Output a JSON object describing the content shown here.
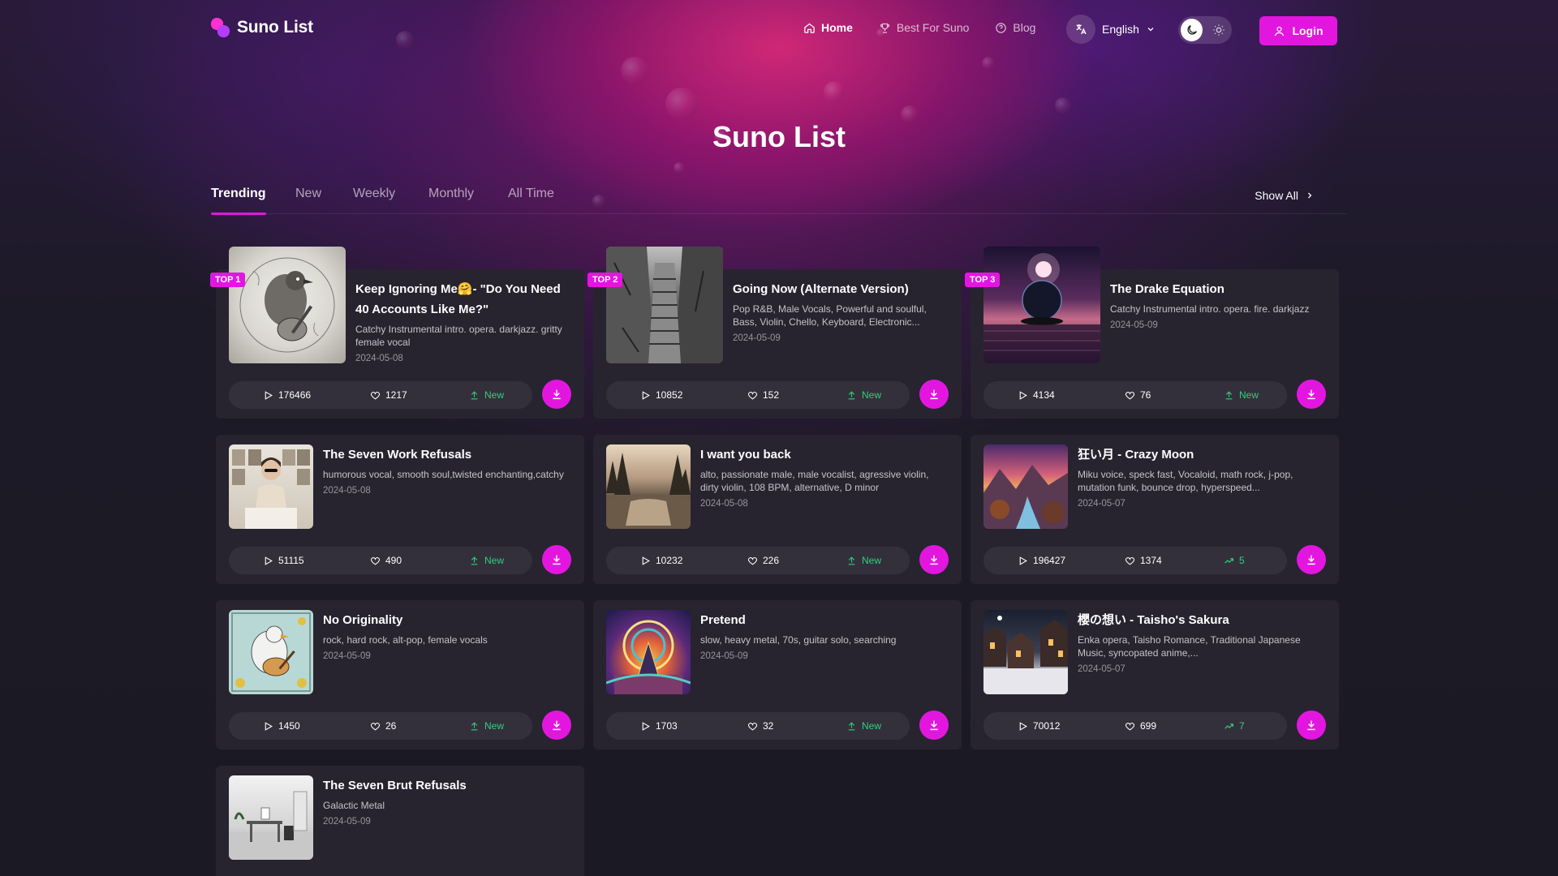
{
  "brand": {
    "name": "Suno List"
  },
  "nav": {
    "home": "Home",
    "best": "Best For Suno",
    "blog": "Blog",
    "language": "English",
    "login": "Login"
  },
  "hero": {
    "title": "Suno List"
  },
  "tabs": [
    "Trending",
    "New",
    "Weekly",
    "Monthly",
    "All Time"
  ],
  "show_all": "Show All",
  "colors": {
    "accent": "#e316e0",
    "trend_green": "#2fd17a",
    "card_bg": "#272430",
    "page_bg": "#1b1a24"
  },
  "songs": [
    {
      "rank": "TOP 1",
      "title": "Keep Ignoring Me🤗- \"Do You Need 40 Accounts Like Me?\"",
      "tags": "Catchy Instrumental intro. opera. darkjazz. gritty female vocal",
      "date": "2024-05-08",
      "plays": "176466",
      "likes": "1217",
      "trend": "New",
      "trend_icon": "upload-icon"
    },
    {
      "rank": "TOP 2",
      "title": "Going Now (Alternate Version)",
      "tags": "Pop R&B, Male Vocals, Powerful and soulful, Bass, Violin, Chello, Keyboard, Electronic...",
      "date": "2024-05-09",
      "plays": "10852",
      "likes": "152",
      "trend": "New",
      "trend_icon": "upload-icon"
    },
    {
      "rank": "TOP 3",
      "title": "The Drake Equation",
      "tags": "Catchy Instrumental intro. opera. fire. darkjazz",
      "date": "2024-05-09",
      "plays": "4134",
      "likes": "76",
      "trend": "New",
      "trend_icon": "upload-icon"
    },
    {
      "title": "The Seven Work Refusals",
      "tags": "humorous vocal, smooth soul,twisted enchanting,catchy",
      "date": "2024-05-08",
      "plays": "51115",
      "likes": "490",
      "trend": "New",
      "trend_icon": "upload-icon"
    },
    {
      "title": "I want you back",
      "tags": "alto, passionate male, male vocalist, agressive violin, dirty violin, 108 BPM, alternative, D minor",
      "date": "2024-05-08",
      "plays": "10232",
      "likes": "226",
      "trend": "New",
      "trend_icon": "upload-icon"
    },
    {
      "title": "狂い月 - Crazy Moon",
      "tags": "Miku voice, speck fast, Vocaloid, math rock, j-pop, mutation funk, bounce drop, hyperspeed...",
      "date": "2024-05-07",
      "plays": "196427",
      "likes": "1374",
      "trend": "5",
      "trend_icon": "trending-up-icon"
    },
    {
      "title": "No Originality",
      "tags": "rock, hard rock, alt-pop, female vocals",
      "date": "2024-05-09",
      "plays": "1450",
      "likes": "26",
      "trend": "New",
      "trend_icon": "upload-icon"
    },
    {
      "title": "Pretend",
      "tags": "slow, heavy metal, 70s, guitar solo, searching",
      "date": "2024-05-09",
      "plays": "1703",
      "likes": "32",
      "trend": "New",
      "trend_icon": "upload-icon"
    },
    {
      "title": "櫻の想い - Taisho's Sakura",
      "tags": "Enka opera, Taisho Romance, Traditional Japanese Music, syncopated anime,...",
      "date": "2024-05-07",
      "plays": "70012",
      "likes": "699",
      "trend": "7",
      "trend_icon": "trending-up-icon"
    },
    {
      "title": "The Seven Brut Refusals",
      "tags": "Galactic Metal",
      "date": "2024-05-09"
    }
  ]
}
